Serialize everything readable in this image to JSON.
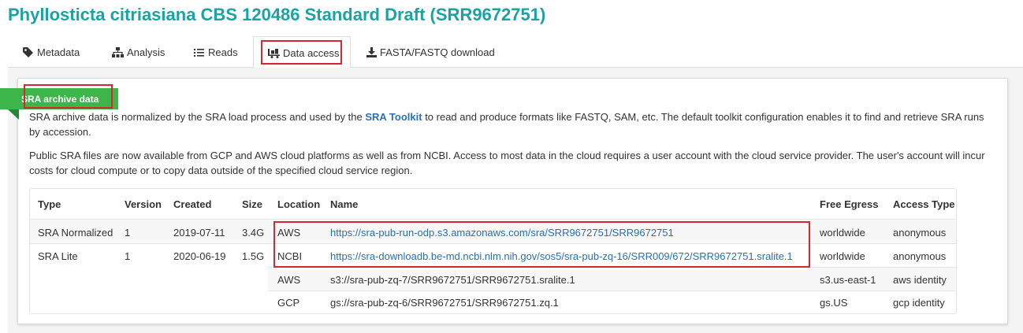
{
  "page": {
    "title": "Phyllosticta citriasiana CBS 120486 Standard Draft (SRR9672751)"
  },
  "tabs": [
    {
      "label": "Metadata",
      "icon": "tag-icon"
    },
    {
      "label": "Analysis",
      "icon": "sitemap-icon"
    },
    {
      "label": "Reads",
      "icon": "list-icon"
    },
    {
      "label": "Data access",
      "icon": "truck-icon",
      "active": true
    },
    {
      "label": "FASTA/FASTQ download",
      "icon": "download-icon"
    }
  ],
  "section": {
    "badge": "SRA archive data",
    "p1_before": "SRA archive data is normalized by the SRA load process and used by the ",
    "p1_link": "SRA Toolkit",
    "p1_after": " to read and produce formats like FASTQ, SAM, etc. The default toolkit configuration enables it to find and retrieve SRA runs by accession.",
    "p2": "Public SRA files are now available from GCP and AWS cloud platforms as well as from NCBI. Access to most data in the cloud requires a user account with the cloud service provider. The user's account will incur costs for cloud compute or to copy data outside of the specified cloud service region."
  },
  "table": {
    "headers": {
      "type": "Type",
      "version": "Version",
      "created": "Created",
      "size": "Size",
      "location": "Location",
      "name": "Name",
      "egress": "Free Egress",
      "access": "Access Type"
    },
    "rows": [
      {
        "type": "SRA Normalized",
        "version": "1",
        "created": "2019-07-11",
        "size": "3.4G",
        "location": "AWS",
        "name": "https://sra-pub-run-odp.s3.amazonaws.com/sra/SRR9672751/SRR9672751",
        "egress": "worldwide",
        "access": "anonymous"
      },
      {
        "type": "SRA Lite",
        "version": "1",
        "created": "2020-06-19",
        "size": "1.5G",
        "location": "NCBI",
        "name": "https://sra-downloadb.be-md.ncbi.nlm.nih.gov/sos5/sra-pub-zq-16/SRR009/672/SRR9672751.sralite.1",
        "egress": "worldwide",
        "access": "anonymous"
      },
      {
        "location": "AWS",
        "name": "s3://sra-pub-zq-7/SRR9672751/SRR9672751.sralite.1",
        "egress": "s3.us-east-1",
        "access": "aws identity"
      },
      {
        "location": "GCP",
        "name": "gs://sra-pub-zq-6/SRR9672751/SRR9672751.zq.1",
        "egress": "gs.US",
        "access": "gcp identity"
      }
    ]
  },
  "colors": {
    "title": "#1aa3a3",
    "badge": "#3cb64a",
    "link": "#2a6fb8",
    "highlight": "#d9262e"
  }
}
